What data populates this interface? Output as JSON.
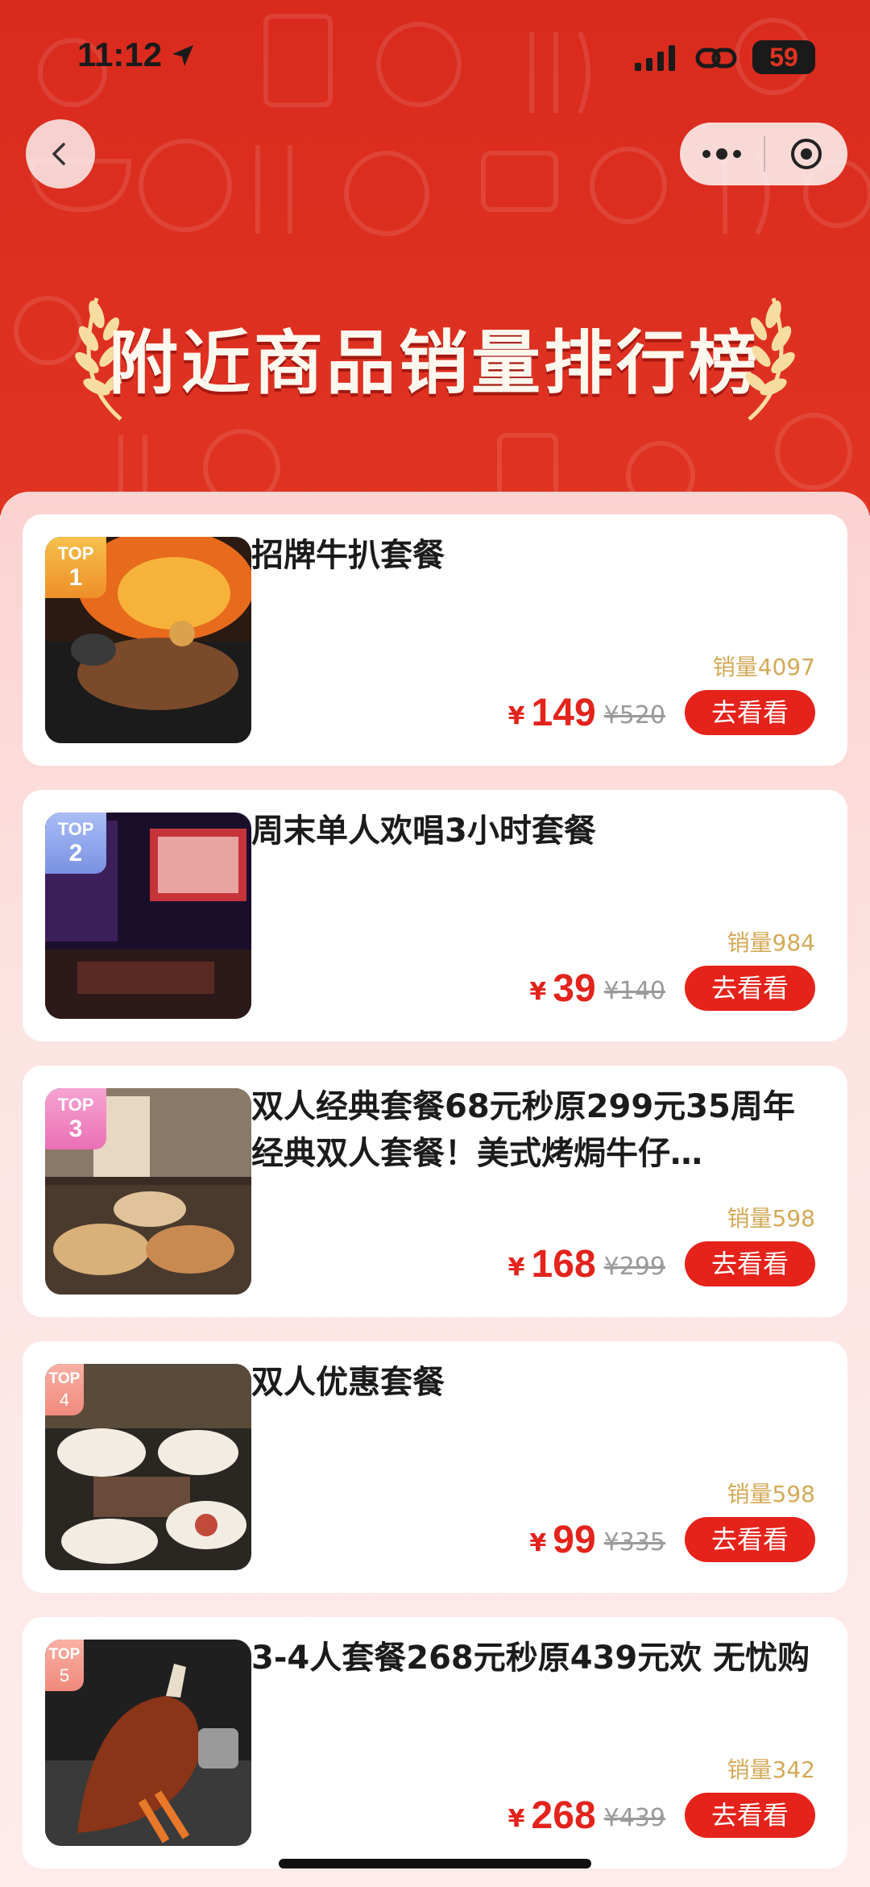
{
  "status_bar": {
    "time": "11:12",
    "battery": "59",
    "icons": [
      "location-arrow-icon",
      "signal-icon",
      "link-icon",
      "battery-icon"
    ]
  },
  "nav": {
    "back_icon": "chevron-left-icon",
    "more_icon": "more-dots-icon",
    "target_icon": "target-icon"
  },
  "banner": {
    "title": "附近商品销量排行榜"
  },
  "colors": {
    "header_red": "#dd2f20",
    "price_red": "#e3231c",
    "sales_gold": "#d3a957",
    "button_red": "#e5231b"
  },
  "items": [
    {
      "rank_label": "TOP",
      "rank": "1",
      "title": "招牌牛扒套餐",
      "sales": "销量4097",
      "currency": "¥",
      "price": "149",
      "original_price": "¥520",
      "button": "去看看"
    },
    {
      "rank_label": "TOP",
      "rank": "2",
      "title": "周末单人欢唱3小时套餐",
      "sales": "销量984",
      "currency": "¥",
      "price": "39",
      "original_price": "¥140",
      "button": "去看看"
    },
    {
      "rank_label": "TOP",
      "rank": "3",
      "title": "双人经典套餐68元秒原299元35周年经典双人套餐！美式烤焗牛仔…",
      "sales": "销量598",
      "currency": "¥",
      "price": "168",
      "original_price": "¥299",
      "button": "去看看"
    },
    {
      "rank_label": "TOP",
      "rank": "4",
      "title": "双人优惠套餐",
      "sales": "销量598",
      "currency": "¥",
      "price": "99",
      "original_price": "¥335",
      "button": "去看看"
    },
    {
      "rank_label": "TOP",
      "rank": "5",
      "title": "3-4人套餐268元秒原439元欢 无忧购",
      "sales": "销量342",
      "currency": "¥",
      "price": "268",
      "original_price": "¥439",
      "button": "去看看"
    }
  ]
}
